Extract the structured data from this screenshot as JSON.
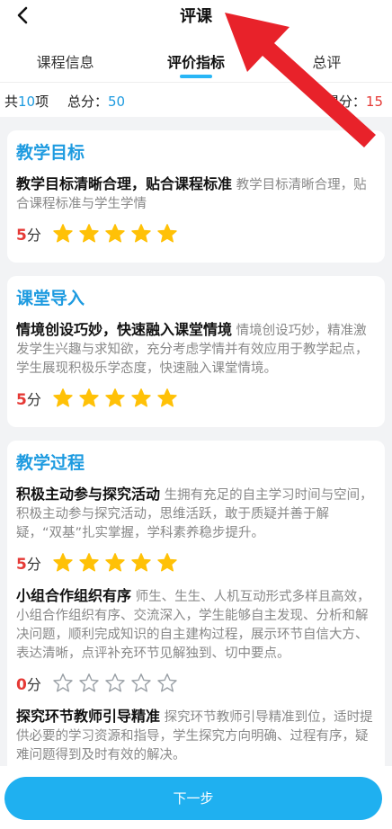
{
  "nav": {
    "title": "评课"
  },
  "tabs": [
    {
      "label": "课程信息",
      "active": false
    },
    {
      "label": "评价指标",
      "active": true
    },
    {
      "label": "总评",
      "active": false
    }
  ],
  "summary": {
    "count_prefix": "共",
    "count": "10",
    "count_suffix": "项",
    "total_label": "总分：",
    "total": "50",
    "score_label": "得分：",
    "score": "15"
  },
  "sections": [
    {
      "title": "教学目标",
      "items": [
        {
          "heading": "教学目标清晰合理，贴合课程标准",
          "text": "教学目标清晰合理，贴合课程标准与学生学情",
          "score": "5",
          "score_unit": "分",
          "stars": 5
        }
      ]
    },
    {
      "title": "课堂导入",
      "items": [
        {
          "heading": "情境创设巧妙，快速融入课堂情境",
          "text": "情境创设巧妙，精准激发学生兴趣与求知欲，充分考虑学情并有效应用于教学起点，学生展现积极乐学态度，快速融入课堂情境。",
          "score": "5",
          "score_unit": "分",
          "stars": 5
        }
      ]
    },
    {
      "title": "教学过程",
      "items": [
        {
          "heading": "积极主动参与探究活动",
          "text": "生拥有充足的自主学习时间与空间，积极主动参与探究活动，思维活跃，敢于质疑并善于解疑，“双基”扎实掌握，学科素养稳步提升。",
          "score": "5",
          "score_unit": "分",
          "stars": 5
        },
        {
          "heading": "小组合作组织有序",
          "text": "师生、生生、人机互动形式多样且高效，小组合作组织有序、交流深入，学生能够自主发现、分析和解决问题，顺利完成知识的自主建构过程，展示环节自信大方、表达清晰，点评补充环节见解独到、切中要点。",
          "score": "0",
          "score_unit": "分",
          "stars": 0
        },
        {
          "heading": "探究环节教师引导精准",
          "text": "探究环节教师引导精准到位，适时提供必要的学习资源和指导，学生探究方向明确、过程有序，疑难问题得到及时有效的解决。",
          "score": "",
          "score_unit": "",
          "stars": 0
        }
      ]
    }
  ],
  "footer": {
    "next_label": "下一步"
  },
  "colors": {
    "accent": "#1e9be0",
    "button": "#1fb0f0",
    "star": "#ffc107",
    "score": "#e53935",
    "pointer": "#e8222a"
  }
}
